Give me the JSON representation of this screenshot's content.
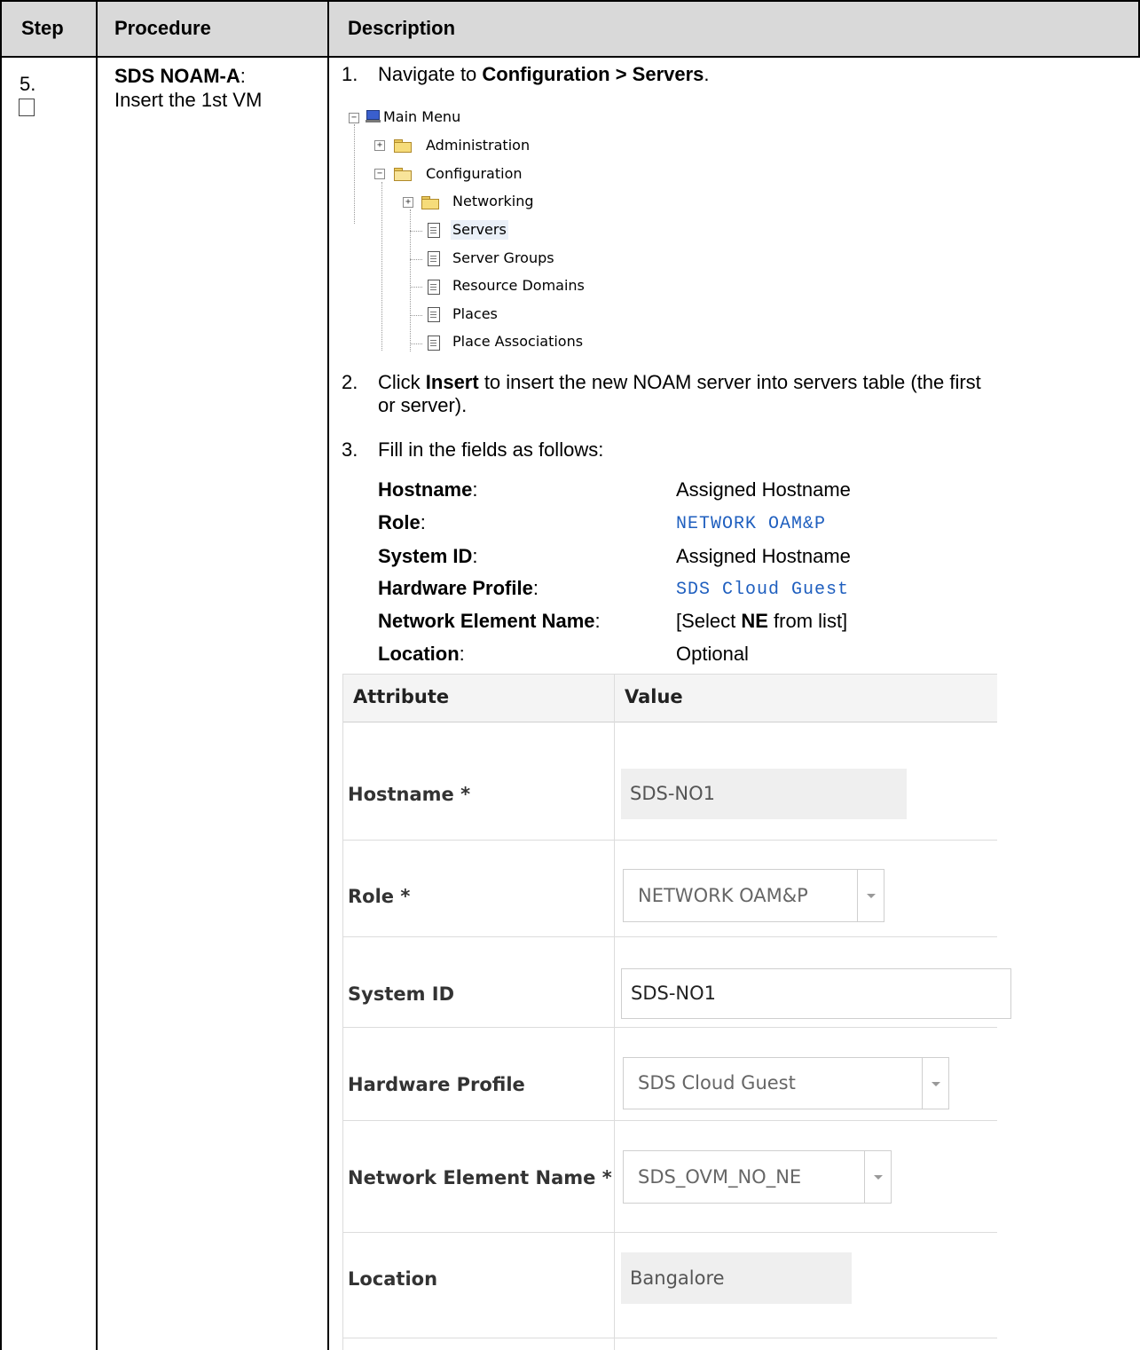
{
  "header": {
    "step": "Step",
    "procedure": "Procedure",
    "description": "Description"
  },
  "row": {
    "step_number": "5.",
    "procedure_title": "SDS NOAM-A",
    "procedure_colon": ":",
    "procedure_text": "Insert the 1st VM"
  },
  "instructions": {
    "item1_num": "1.",
    "item1_pre": "Navigate to ",
    "item1_bold": "Configuration > Servers",
    "item1_post": ".",
    "item2_num": "2.",
    "item2_pre": "Click ",
    "item2_bold": "Insert",
    "item2_post": " to insert the new NOAM server into servers table (the first",
    "item2_line2": "or server).",
    "item3_num": "3.",
    "item3_text": "Fill in the fields as follows:"
  },
  "tree": {
    "root": "Main Menu",
    "administration": "Administration",
    "configuration": "Configuration",
    "networking": "Networking",
    "servers": "Servers",
    "server_groups": "Server Groups",
    "resource_domains": "Resource Domains",
    "places": "Places",
    "place_associations": "Place Associations"
  },
  "fields_list": [
    {
      "label": "Hostname",
      "value": "Assigned Hostname",
      "mono": false
    },
    {
      "label": "Role",
      "value": "NETWORK OAM&P",
      "mono": true
    },
    {
      "label": "System ID",
      "value": "Assigned Hostname",
      "mono": false
    },
    {
      "label": "Hardware Profile",
      "value": "SDS Cloud Guest",
      "mono": true
    },
    {
      "label": "Network Element Name",
      "value_pre": "[Select ",
      "value_bold": "NE",
      "value_post": " from list]",
      "mono": false
    },
    {
      "label": "Location",
      "value": "Optional",
      "mono": false
    }
  ],
  "form": {
    "col_attribute": "Attribute",
    "col_value": "Value",
    "hostname_label": "Hostname *",
    "hostname_value": "SDS-NO1",
    "role_label": "Role *",
    "role_value": "NETWORK OAM&P",
    "system_id_label": "System ID",
    "system_id_value": "SDS-NO1",
    "hardware_label": "Hardware Profile",
    "hardware_value": "SDS Cloud Guest",
    "ne_label": "Network Element Name *",
    "ne_value": "SDS_OVM_NO_NE",
    "location_label": "Location",
    "location_value": "Bangalore"
  }
}
